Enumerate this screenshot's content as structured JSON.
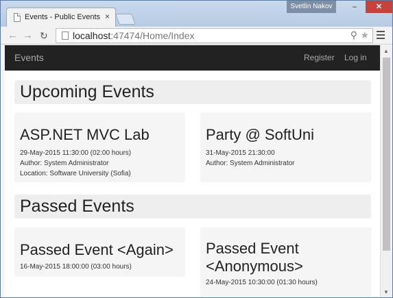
{
  "browser": {
    "tab_title": "Events - Public Events",
    "tab_close": "×",
    "user_name": "Svetlin Nakov",
    "url_host": "localhost",
    "url_rest": ":47474/Home/Index",
    "minimize": "–",
    "maximize": "□",
    "close": "✕"
  },
  "navbar": {
    "brand": "Events",
    "register": "Register",
    "login": "Log in"
  },
  "upcoming": {
    "heading": "Upcoming Events",
    "events": [
      {
        "title": "ASP.NET MVC Lab",
        "date": "29-May-2015 11:30:00 (02:00 hours)",
        "author": "Author: System Administrator",
        "location": "Location: Software University (Sofia)"
      },
      {
        "title": "Party @ SoftUni",
        "date": "31-May-2015 21:30:00",
        "author": "Author: System Administrator"
      }
    ]
  },
  "passed": {
    "heading": "Passed Events",
    "events": [
      {
        "title": "Passed Event <Again>",
        "date": "16-May-2015 18:00:00 (03:00 hours)"
      },
      {
        "title_line1": "Passed Event",
        "title_line2": "<Anonymous>",
        "date": "24-May-2015 10:30:00 (01:30 hours)"
      }
    ]
  }
}
